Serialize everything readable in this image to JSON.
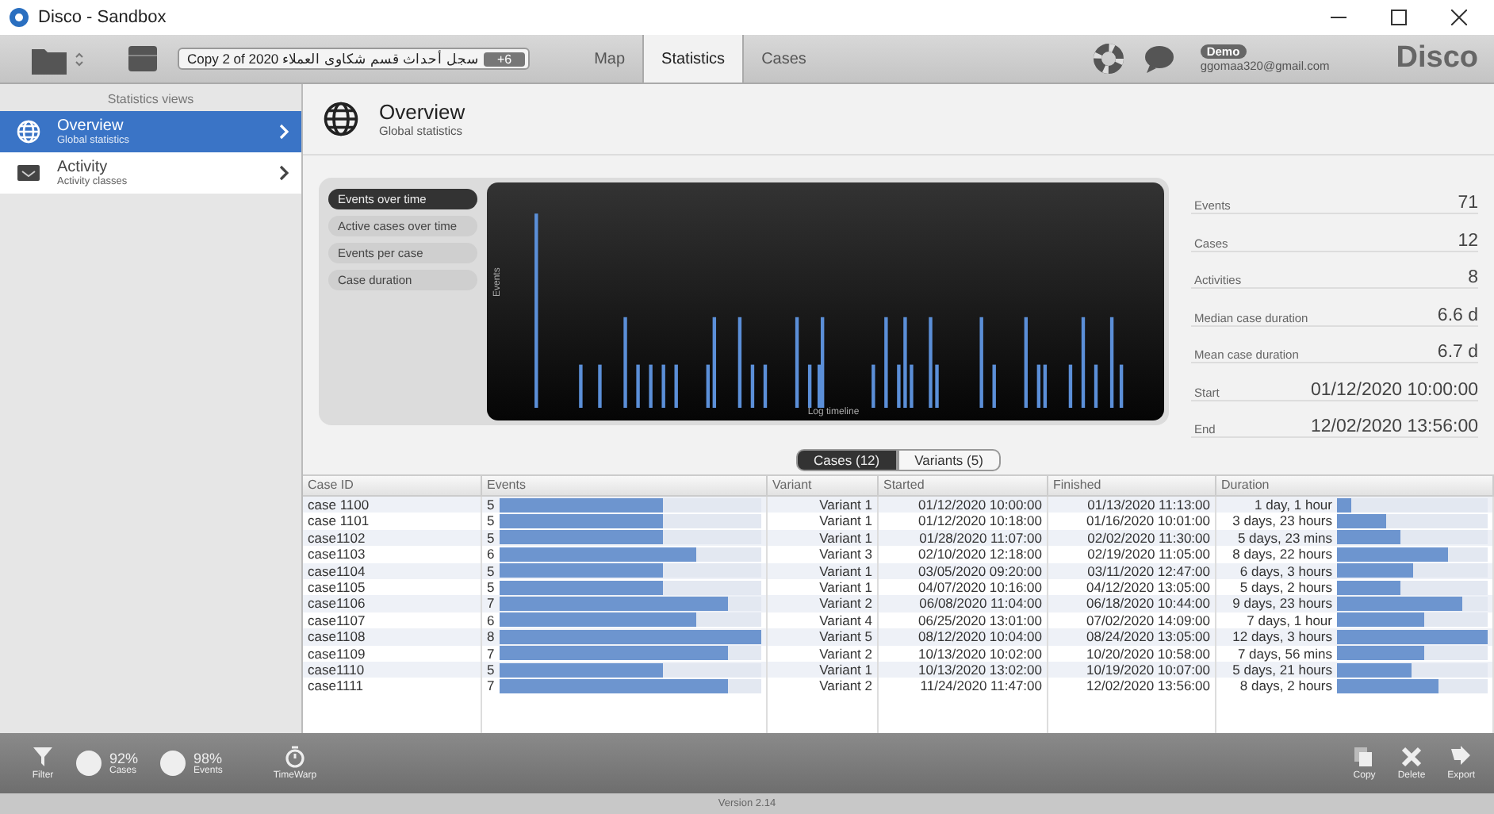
{
  "window": {
    "title": "Disco - Sandbox"
  },
  "toolbar": {
    "dataset": "Copy 2 of 2020 سجل أحداث قسم شكاوى العملاء",
    "dataset_badge": "+6",
    "tabs": [
      {
        "label": "Map",
        "selected": false
      },
      {
        "label": "Statistics",
        "selected": true
      },
      {
        "label": "Cases",
        "selected": false
      }
    ],
    "user_badge": "Demo",
    "user_email": "ggomaa320@gmail.com",
    "logo": "Disco"
  },
  "sidebar": {
    "title": "Statistics views",
    "items": [
      {
        "kind": "globe",
        "label": "Overview",
        "sublabel": "Global statistics",
        "selected": true
      },
      {
        "kind": "activity",
        "label": "Activity",
        "sublabel": "Activity classes",
        "selected": false
      }
    ]
  },
  "header": {
    "title": "Overview",
    "subtitle": "Global statistics"
  },
  "chart_buttons": [
    {
      "label": "Events over time",
      "selected": true
    },
    {
      "label": "Active cases over time",
      "selected": false
    },
    {
      "label": "Events per case",
      "selected": false
    },
    {
      "label": "Case duration",
      "selected": false
    }
  ],
  "chart": {
    "ylabel": "Events",
    "xlabel": "Log timeline"
  },
  "stats": [
    {
      "label": "Events",
      "value": "71"
    },
    {
      "label": "Cases",
      "value": "12"
    },
    {
      "label": "Activities",
      "value": "8"
    },
    {
      "label": "Median case duration",
      "value": "6.6 d"
    },
    {
      "label": "Mean case duration",
      "value": "6.7 d"
    },
    {
      "label": "Start",
      "value": "01/12/2020 10:00:00"
    },
    {
      "label": "End",
      "value": "12/02/2020 13:56:00"
    }
  ],
  "table_tabs": [
    {
      "label": "Cases (12)",
      "selected": true
    },
    {
      "label": "Variants (5)",
      "selected": false
    }
  ],
  "table": {
    "columns": [
      "Case ID",
      "Events",
      "Variant",
      "Started",
      "Finished",
      "Duration"
    ],
    "rows": [
      {
        "id": "case 1100",
        "events": "5",
        "level": 0.625,
        "variant": "Variant 1",
        "started": "01/12/2020 10:00:00",
        "finished": "01/13/2020 11:13:00",
        "duration": "1 day, 1 hour",
        "duration_level": {
          "level": 0.09
        }
      },
      {
        "id": "case 1101",
        "events": "5",
        "level": 0.625,
        "variant": "Variant 1",
        "started": "01/12/2020 10:18:00",
        "finished": "01/16/2020 10:01:00",
        "duration": "3 days, 23 hours",
        "duration_level": {
          "level": 0.33
        }
      },
      {
        "id": "case1102",
        "events": "5",
        "level": 0.625,
        "variant": "Variant 1",
        "started": "01/28/2020 11:07:00",
        "finished": "02/02/2020 11:30:00",
        "duration": "5 days, 23 mins",
        "duration_level": {
          "level": 0.42
        }
      },
      {
        "id": "case1103",
        "events": "6",
        "level": 0.75,
        "variant": "Variant 3",
        "started": "02/10/2020 12:18:00",
        "finished": "02/19/2020 11:05:00",
        "duration": "8 days, 22 hours",
        "duration_level": {
          "level": 0.74
        }
      },
      {
        "id": "case1104",
        "events": "5",
        "level": 0.625,
        "variant": "Variant 1",
        "started": "03/05/2020 09:20:00",
        "finished": "03/11/2020 12:47:00",
        "duration": "6 days, 3 hours",
        "duration_level": {
          "level": 0.51
        }
      },
      {
        "id": "case1105",
        "events": "5",
        "level": 0.625,
        "variant": "Variant 1",
        "started": "04/07/2020 10:16:00",
        "finished": "04/12/2020 13:05:00",
        "duration": "5 days, 2 hours",
        "duration_level": {
          "level": 0.42
        }
      },
      {
        "id": "case1106",
        "events": "7",
        "level": 0.875,
        "variant": "Variant 2",
        "started": "06/08/2020 11:04:00",
        "finished": "06/18/2020 10:44:00",
        "duration": "9 days, 23 hours",
        "duration_level": {
          "level": 0.83
        }
      },
      {
        "id": "case1107",
        "events": "6",
        "level": 0.75,
        "variant": "Variant 4",
        "started": "06/25/2020 13:01:00",
        "finished": "07/02/2020 14:09:00",
        "duration": "7 days, 1 hour",
        "duration_level": {
          "level": 0.58
        }
      },
      {
        "id": "case1108",
        "events": "8",
        "level": 1,
        "variant": "Variant 5",
        "started": "08/12/2020 10:04:00",
        "finished": "08/24/2020 13:05:00",
        "duration": "12 days, 3 hours",
        "duration_level": {
          "level": 1
        }
      },
      {
        "id": "case1109",
        "events": "7",
        "level": 0.875,
        "variant": "Variant 2",
        "started": "10/13/2020 10:02:00",
        "finished": "10/20/2020 10:58:00",
        "duration": "7 days, 56 mins",
        "duration_level": {
          "level": 0.58
        }
      },
      {
        "id": "case1110",
        "events": "5",
        "level": 0.625,
        "variant": "Variant 1",
        "started": "10/13/2020 13:02:00",
        "finished": "10/19/2020 10:07:00",
        "duration": "5 days, 21 hours",
        "duration_level": {
          "level": 0.49
        }
      },
      {
        "id": "case1111",
        "events": "7",
        "level": 0.875,
        "variant": "Variant 2",
        "started": "11/24/2020 11:47:00",
        "finished": "12/02/2020 13:56:00",
        "duration": "8 days, 2 hours",
        "duration_level": {
          "level": 0.67
        }
      }
    ]
  },
  "footer": {
    "filter": "Filter",
    "meters": [
      {
        "value": "92%",
        "label": "Cases"
      },
      {
        "value": "98%",
        "label": "Events"
      }
    ],
    "timewarp": "TimeWarp",
    "actions": [
      {
        "kind": "copy",
        "label": "Copy"
      },
      {
        "kind": "delete",
        "label": "Delete"
      },
      {
        "kind": "export",
        "label": "Export"
      }
    ]
  },
  "status_bar": {
    "version": "Version 2.14"
  }
}
